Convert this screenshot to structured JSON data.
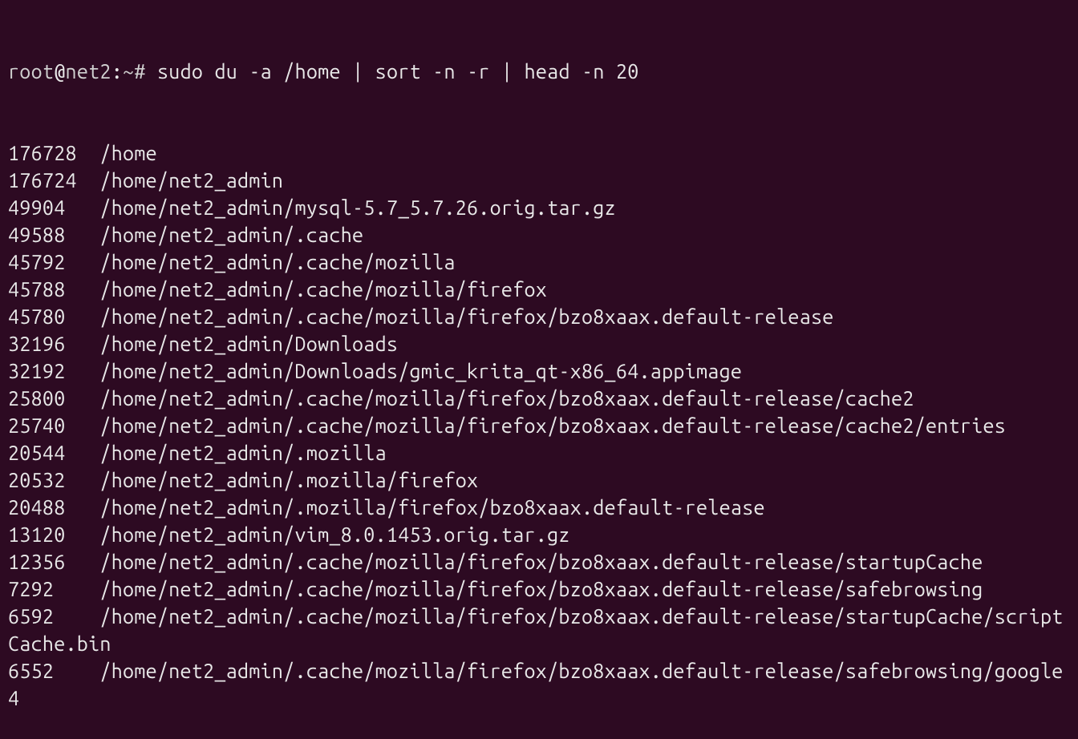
{
  "prompt": {
    "user": "root",
    "at": "@",
    "host": "net2",
    "colon": ":",
    "path": "~",
    "symbol": "#",
    "spacer": " "
  },
  "command": "sudo du -a /home | sort -n -r | head -n 20",
  "rows": [
    {
      "size": "176728",
      "path": "/home"
    },
    {
      "size": "176724",
      "path": "/home/net2_admin"
    },
    {
      "size": "49904",
      "path": "/home/net2_admin/mysql-5.7_5.7.26.orig.tar.gz"
    },
    {
      "size": "49588",
      "path": "/home/net2_admin/.cache"
    },
    {
      "size": "45792",
      "path": "/home/net2_admin/.cache/mozilla"
    },
    {
      "size": "45788",
      "path": "/home/net2_admin/.cache/mozilla/firefox"
    },
    {
      "size": "45780",
      "path": "/home/net2_admin/.cache/mozilla/firefox/bzo8xaax.default-release"
    },
    {
      "size": "32196",
      "path": "/home/net2_admin/Downloads"
    },
    {
      "size": "32192",
      "path": "/home/net2_admin/Downloads/gmic_krita_qt-x86_64.appimage"
    },
    {
      "size": "25800",
      "path": "/home/net2_admin/.cache/mozilla/firefox/bzo8xaax.default-release/cache2"
    },
    {
      "size": "25740",
      "path": "/home/net2_admin/.cache/mozilla/firefox/bzo8xaax.default-release/cache2/entries"
    },
    {
      "size": "20544",
      "path": "/home/net2_admin/.mozilla"
    },
    {
      "size": "20532",
      "path": "/home/net2_admin/.mozilla/firefox"
    },
    {
      "size": "20488",
      "path": "/home/net2_admin/.mozilla/firefox/bzo8xaax.default-release"
    },
    {
      "size": "13120",
      "path": "/home/net2_admin/vim_8.0.1453.orig.tar.gz"
    },
    {
      "size": "12356",
      "path": "/home/net2_admin/.cache/mozilla/firefox/bzo8xaax.default-release/startupCache"
    },
    {
      "size": "7292",
      "path": "/home/net2_admin/.cache/mozilla/firefox/bzo8xaax.default-release/safebrowsing"
    },
    {
      "size": "6592",
      "path": "/home/net2_admin/.cache/mozilla/firefox/bzo8xaax.default-release/startupCache/scriptCache.bin"
    },
    {
      "size": "6552",
      "path": "/home/net2_admin/.cache/mozilla/firefox/bzo8xaax.default-release/safebrowsing/google4"
    }
  ],
  "size_col_width": 8
}
